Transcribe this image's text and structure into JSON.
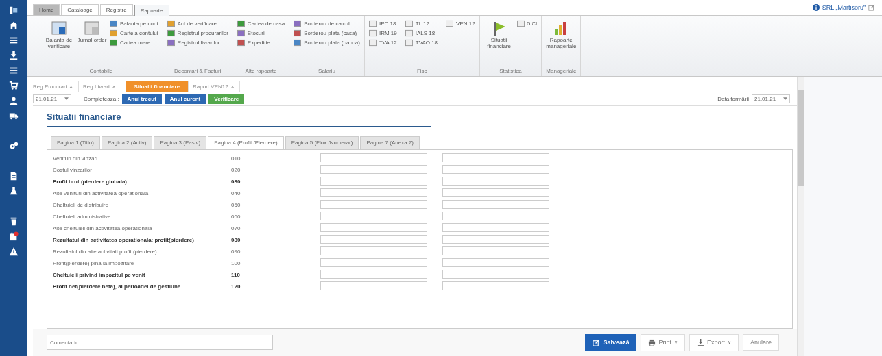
{
  "menu_tabs": [
    {
      "label": "Home",
      "selected": false
    },
    {
      "label": "Cataloage",
      "selected": false
    },
    {
      "label": "Registre",
      "selected": false
    },
    {
      "label": "Rapoarte",
      "selected": true
    }
  ],
  "company": "SRL „Martisoru”",
  "ribbon_groups": [
    {
      "title": "Contabile",
      "large": [
        "Balanta de verificare",
        "Jurnal order"
      ],
      "small": [
        "Balanta pe cont",
        "Cartela contului",
        "Cartea mare"
      ]
    },
    {
      "title": "Decontari & Facturi",
      "small": [
        "Act de verificare",
        "Registrul procurarilor",
        "Registrul livrarilor"
      ]
    },
    {
      "title": "Alte rapoarte",
      "small": [
        "Cartea de casa",
        "Stocuri",
        "Expeditie"
      ]
    },
    {
      "title": "Salariu",
      "small": [
        "Borderou de calcul",
        "Borderou plata (casa)",
        "Borderou plata (banca)"
      ]
    },
    {
      "title": "Fisc",
      "small": [
        "IPC 18",
        "IRM 19",
        "TVA 12",
        "TL 12",
        "IALS 18",
        "TVAO 18",
        "VEN 12"
      ]
    },
    {
      "title": "Statistica",
      "large": [
        "Situatii financiare"
      ],
      "small": [
        "5 CI"
      ]
    },
    {
      "title": "Manageriale",
      "large": [
        "Rapoarte manageriale"
      ]
    }
  ],
  "doc_tabs": [
    {
      "label": "Reg Procurari",
      "close": "×",
      "selected": false
    },
    {
      "label": "Reg Livrari",
      "close": "×",
      "selected": false
    },
    {
      "label": "Situatii financiare",
      "selected": true
    },
    {
      "label": "Raport VEN12",
      "close": "×",
      "selected": false
    }
  ],
  "toolbar": {
    "period": "21.01.21",
    "fill_label": "Completeaza :",
    "buttons": [
      {
        "label": "Anul trecut",
        "kind": "blue"
      },
      {
        "label": "Anul curent",
        "kind": "blue"
      },
      {
        "label": "Verificare",
        "kind": "green"
      }
    ],
    "date_label": "Data formării",
    "date": "21.01.21"
  },
  "title": "Situatii financiare",
  "page_tabs": [
    {
      "label": "Pagina 1 (Titlu)",
      "selected": false
    },
    {
      "label": "Pagina 2 (Activ)",
      "selected": false
    },
    {
      "label": "Pagina 3 (Pasiv)",
      "selected": false
    },
    {
      "label": "Pagina 4 (Profit /Pierdere)",
      "selected": true
    },
    {
      "label": "Pagina 5 (Flux /Numerar)",
      "selected": false
    },
    {
      "label": "Pagina 7 (Anexa 7)",
      "selected": false
    }
  ],
  "rows": [
    {
      "label": "Venituri din vinzari",
      "code": "010",
      "bold": false
    },
    {
      "label": "Costul vinzarilor",
      "code": "020",
      "bold": false
    },
    {
      "label": "Profit brut (pierdere globala)",
      "code": "030",
      "bold": true
    },
    {
      "label": "Alte venituri din activitatea operationala",
      "code": "040",
      "bold": false
    },
    {
      "label": "Cheltuieli de distribuire",
      "code": "050",
      "bold": false
    },
    {
      "label": "Cheltuieli administrative",
      "code": "060",
      "bold": false
    },
    {
      "label": "Alte cheltuieli din activitatea operationala",
      "code": "070",
      "bold": false
    },
    {
      "label": "Rezultatul din activitatea operationala: profit(pierdere)",
      "code": "080",
      "bold": true
    },
    {
      "label": "Rezultatul din alte activitati:profit (pierdere)",
      "code": "090",
      "bold": false
    },
    {
      "label": "Profit(pierdere) pina la impozitare",
      "code": "100",
      "bold": false
    },
    {
      "label": "Cheltuieli privind impozitul pe venit",
      "code": "110",
      "bold": true
    },
    {
      "label": "Profit net(pierdere neta), al perioadei de gestiune",
      "code": "120",
      "bold": true
    }
  ],
  "footer": {
    "comment_placeholder": "Comentariu",
    "buttons": [
      {
        "label": "Salvează",
        "kind": "primary"
      },
      {
        "label": "Print",
        "kind": "plain",
        "caret": "∨"
      },
      {
        "label": "Export",
        "kind": "plain",
        "caret": "∨"
      },
      {
        "label": "Anulare",
        "kind": "plain"
      }
    ]
  }
}
